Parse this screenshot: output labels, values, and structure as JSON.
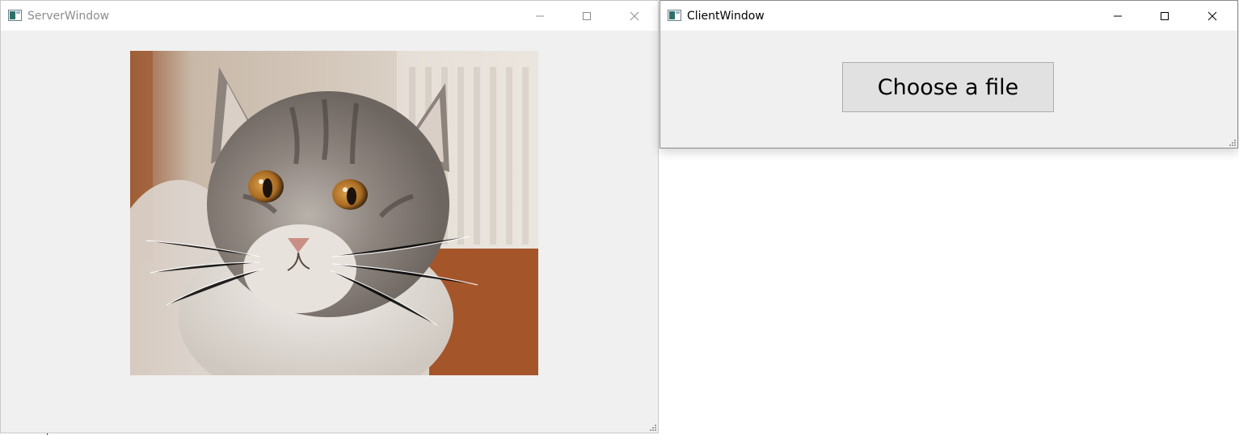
{
  "server_window": {
    "title": "ServerWindow",
    "image": {
      "subject": "tabby kitten looking at camera",
      "icon": "cat-photo"
    }
  },
  "client_window": {
    "title": "ClientWindow",
    "choose_button_label": "Choose a file"
  },
  "colors": {
    "window_bg": "#f0f0f0",
    "titlebar_bg": "#ffffff",
    "button_bg": "#e1e1e1",
    "button_border": "#adadad",
    "inactive_title": "#8c8c8c"
  }
}
